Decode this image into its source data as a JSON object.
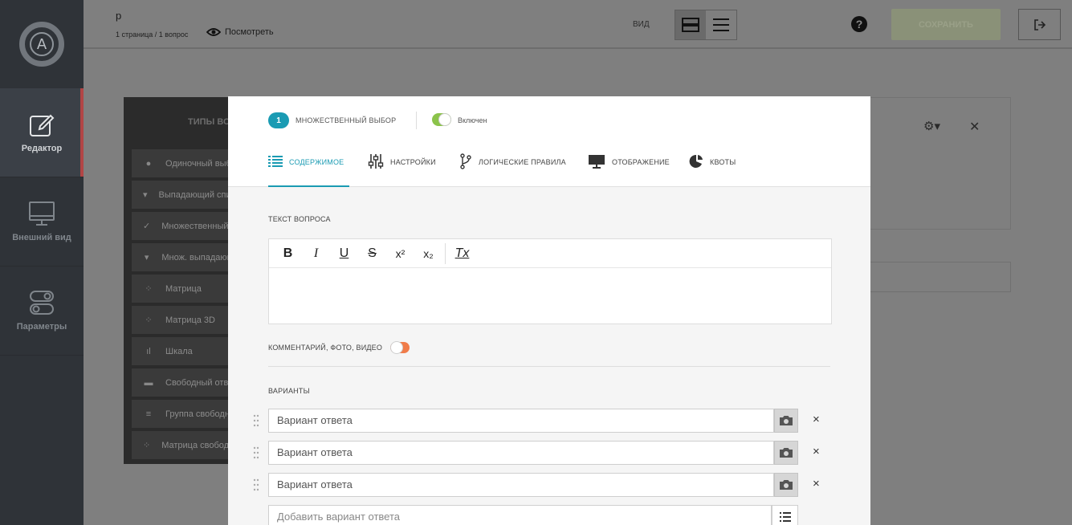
{
  "sidebar": {
    "logo_letter": "A",
    "items": [
      {
        "label": "Редактор",
        "icon": "edit-icon",
        "active": true
      },
      {
        "label": "Внешний вид",
        "icon": "monitor-icon",
        "active": false
      },
      {
        "label": "Параметры",
        "icon": "toggles-icon",
        "active": false
      }
    ]
  },
  "header": {
    "title": "р",
    "meta": "1 страница / 1 вопрос",
    "preview_label": "Посмотреть",
    "view_label": "ВИД",
    "save_label": "СОХРАНИТЬ"
  },
  "background": {
    "types_title": "ТИПЫ ВО",
    "types": [
      {
        "label": "Одиночный выбор",
        "icon": "radio-icon"
      },
      {
        "label": "Выпадающий список",
        "icon": "dropdown-icon"
      },
      {
        "label": "Множественный выбор",
        "icon": "checkmark-icon"
      },
      {
        "label": "Множ. выпадающий",
        "icon": "dropdown-icon"
      },
      {
        "label": "Матрица",
        "icon": "matrix-icon"
      },
      {
        "label": "Матрица 3D",
        "icon": "matrix-icon"
      },
      {
        "label": "Шкала",
        "icon": "scale-icon"
      },
      {
        "label": "Свободный ответ",
        "icon": "textbox-icon"
      },
      {
        "label": "Группа свободных",
        "icon": "lines-icon"
      },
      {
        "label": "Матрица свободных",
        "icon": "matrix-icon"
      }
    ]
  },
  "modal": {
    "question_number": "1",
    "question_type": "МНОЖЕСТВЕННЫЙ ВЫБОР",
    "enabled_label": "Включен",
    "tabs": [
      {
        "label": "СОДЕРЖИМОЕ",
        "icon": "list-icon",
        "active": true
      },
      {
        "label": "НАСТРОЙКИ",
        "icon": "sliders-icon",
        "active": false
      },
      {
        "label": "ЛОГИЧЕСКИЕ ПРАВИЛА",
        "icon": "branch-icon",
        "active": false
      },
      {
        "label": "ОТОБРАЖЕНИЕ",
        "icon": "monitor-icon",
        "active": false
      },
      {
        "label": "КВОТЫ",
        "icon": "pie-icon",
        "active": false
      }
    ],
    "question_text_label": "ТЕКСТ ВОПРОСА",
    "toolbar": [
      "B",
      "I",
      "U",
      "S",
      "x²",
      "x₂",
      "Tx"
    ],
    "comment_label": "КОММЕНТАРИЙ, ФОТО, ВИДЕО",
    "variants_label": "ВАРИАНТЫ",
    "options": [
      {
        "value": "Вариант ответа"
      },
      {
        "value": "Вариант ответа"
      },
      {
        "value": "Вариант ответа"
      }
    ],
    "add_option_placeholder": "Добавить вариант ответа",
    "delete_symbol": "×"
  }
}
